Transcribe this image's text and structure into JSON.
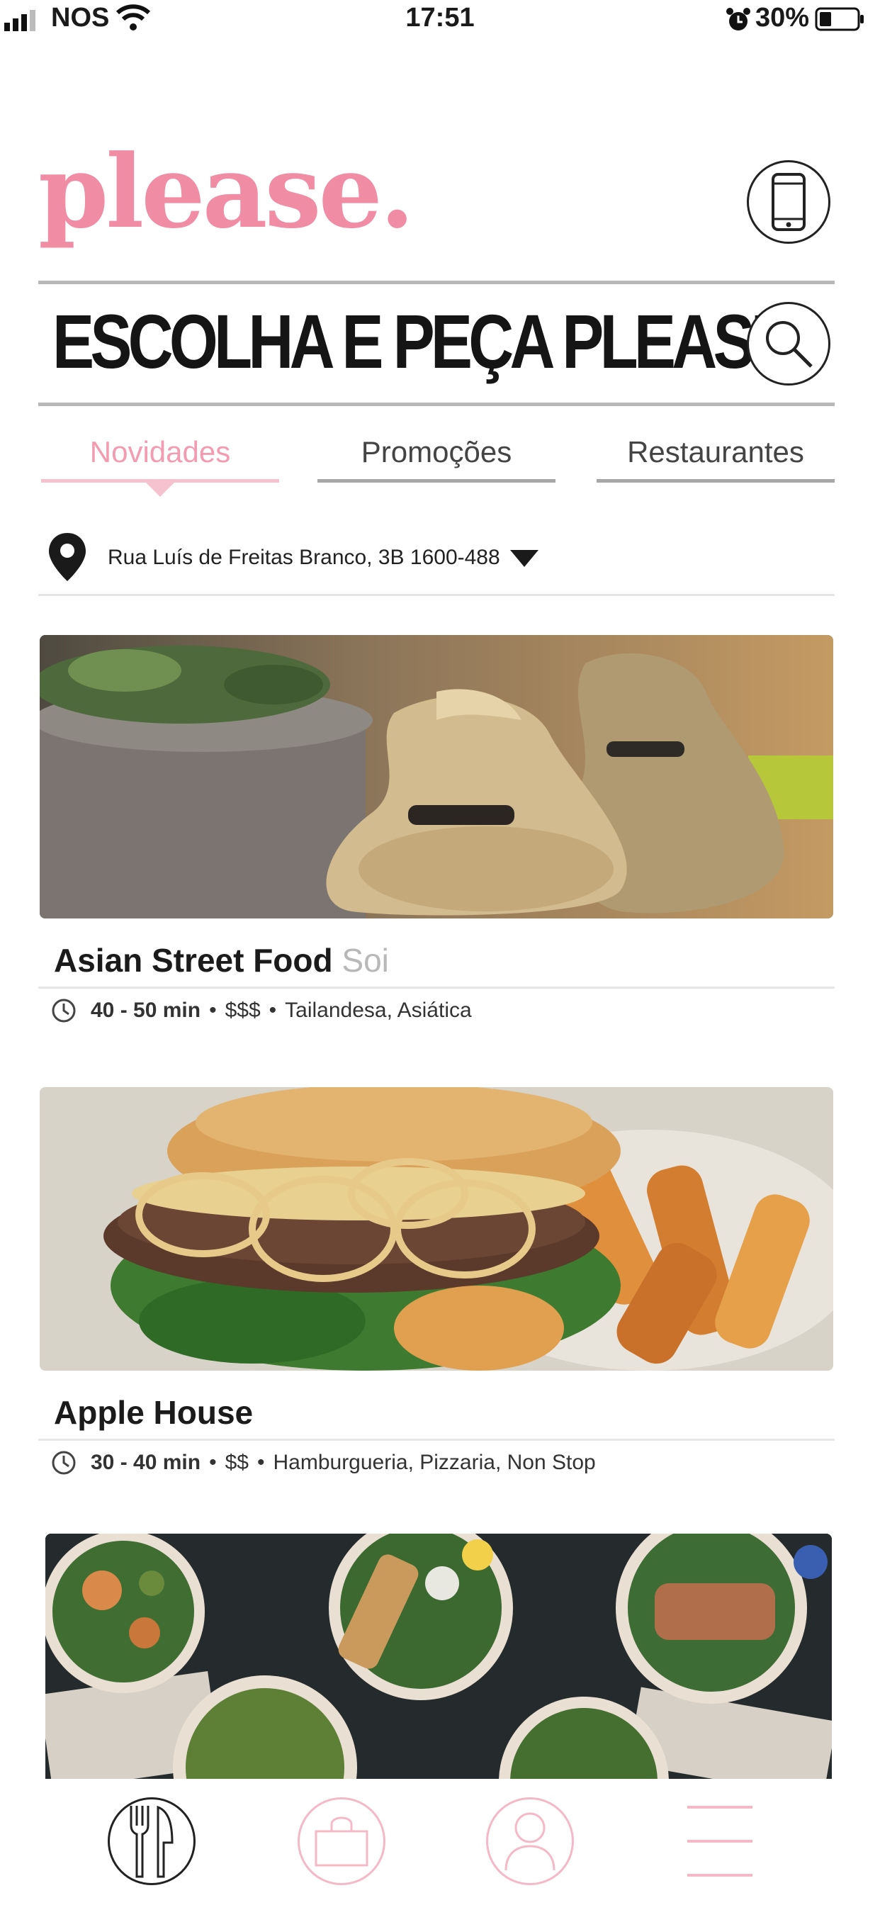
{
  "status_bar": {
    "carrier": "NOS",
    "time": "17:51",
    "battery_percent": "30%"
  },
  "header": {
    "logo_text": "please.",
    "headline": "ESCOLHA E PEÇA PLEASE"
  },
  "tabs": [
    {
      "label": "Novidades",
      "active": true
    },
    {
      "label": "Promoções",
      "active": false
    },
    {
      "label": "Restaurantes",
      "active": false
    }
  ],
  "location": {
    "address": "Rua Luís de Freitas Branco, 3B 1600-488"
  },
  "restaurants": [
    {
      "name": "Asian Street Food",
      "subtitle": "Soi",
      "time": "40 - 50 min",
      "price": "$$$",
      "cuisine": "Tailandesa, Asiática"
    },
    {
      "name": "Apple House",
      "subtitle": "",
      "time": "30 - 40 min",
      "price": "$$",
      "cuisine": "Hamburgueria, Pizzaria, Non Stop"
    }
  ],
  "colors": {
    "brand_pink": "#f08ca4",
    "tab_active": "#f29bb1"
  },
  "icons": {
    "phone": "phone-icon",
    "search": "search-icon",
    "location": "location-pin-icon",
    "clock": "clock-icon",
    "nav_restaurants": "cutlery-icon",
    "nav_bag": "shopping-bag-icon",
    "nav_profile": "user-icon",
    "nav_menu": "hamburger-menu-icon"
  }
}
